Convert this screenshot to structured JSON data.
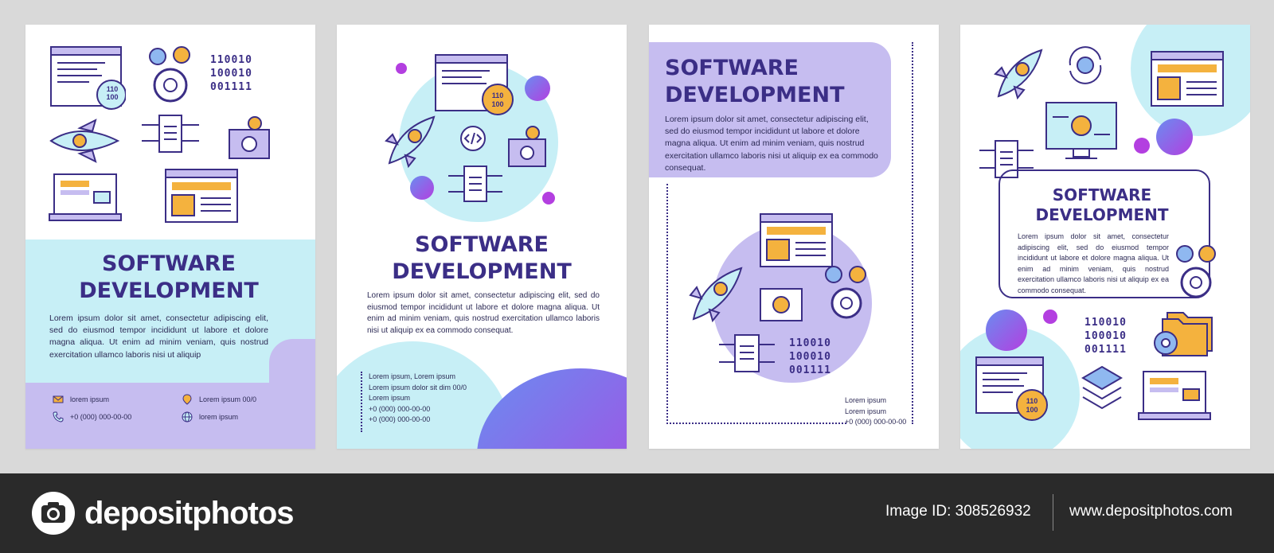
{
  "brochures": [
    {
      "title_line1": "SOFTWARE",
      "title_line2": "DEVELOPMENT",
      "body": "Lorem ipsum dolor sit amet, consectetur adipiscing elit, sed do eiusmod tempor incididunt ut labore et dolore magna aliqua. Ut enim ad minim veniam, quis nostrud exercitation ullamco laboris nisi ut aliquip",
      "binary": [
        "110010",
        "100010",
        "001111"
      ],
      "badge": [
        "110",
        "100"
      ],
      "contacts": {
        "email": "lorem ipsum",
        "location": "Lorem ipsum 00/0",
        "phone": "+0 (000) 000-00-00",
        "web": "lorem ipsum"
      }
    },
    {
      "title_line1": "SOFTWARE",
      "title_line2": "DEVELOPMENT",
      "body": "Lorem ipsum dolor sit amet, consectetur adipiscing elit, sed do eiusmod tempor incididunt ut labore et dolore magna aliqua. Ut enim ad minim veniam, quis nostrud exercitation ullamco laboris nisi ut aliquip ex ea commodo consequat.",
      "badge": [
        "110",
        "100"
      ],
      "contact_lines": [
        "Lorem ipsum, Lorem ipsum",
        "Lorem ipsum dolor sit dim 00/0",
        "Lorem ipsum",
        "+0 (000) 000-00-00",
        "+0 (000) 000-00-00"
      ]
    },
    {
      "title_line1": "SOFTWARE",
      "title_line2": "DEVELOPMENT",
      "body": "Lorem ipsum dolor sit amet, consectetur adipiscing elit, sed do eiusmod tempor incididunt ut labore et dolore magna aliqua. Ut enim ad minim veniam, quis nostrud exercitation ullamco laboris nisi ut aliquip ex ea commodo consequat.",
      "binary": [
        "110010",
        "100010",
        "001111"
      ],
      "contact_lines": [
        "Lorem ipsum",
        "Lorem ipsum",
        "+0 (000) 000-00-00"
      ]
    },
    {
      "title_line1": "SOFTWARE",
      "title_line2": "DEVELOPMENT",
      "body": "Lorem ipsum dolor sit amet, consectetur adipiscing elit, sed do eiusmod tempor incididunt ut labore et dolore magna aliqua. Ut enim ad minim veniam, quis nostrud exercitation ullamco laboris nisi ut aliquip ex ea commodo consequat.",
      "binary": [
        "110010",
        "100010",
        "001111"
      ],
      "badge": [
        "110",
        "100"
      ]
    }
  ],
  "footer": {
    "brand": "depositphotos",
    "image_id": "Image ID: 308526932",
    "site": "www.depositphotos.com"
  },
  "colors": {
    "navy": "#3b2e86",
    "light_blue": "#c7eff6",
    "lavender": "#c6bdf0",
    "orange": "#f4b23e",
    "magenta": "#b33fe0"
  }
}
